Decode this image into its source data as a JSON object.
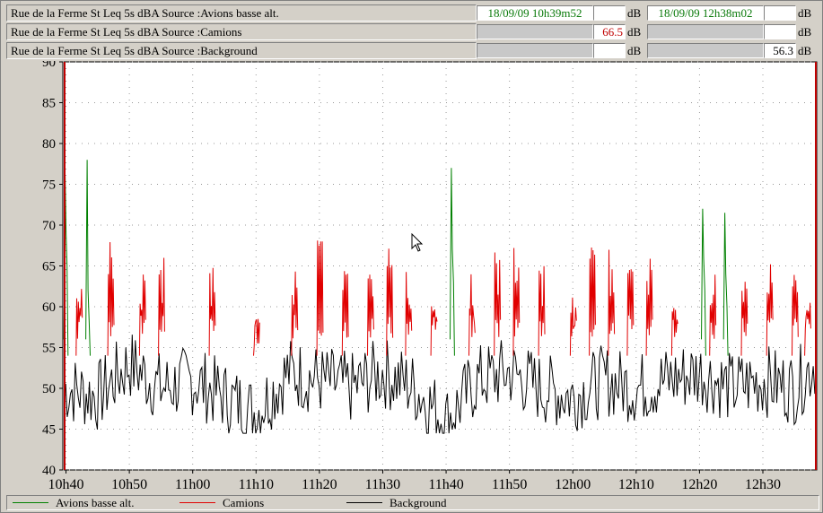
{
  "header_rows": [
    {
      "label": "Rue de la Ferme St  Leq 5s  dBA  Source :Avions basse alt.",
      "value1": "18/09/09 10h39m52",
      "unit1": "dB",
      "value2": "18/09/09 12h38m02",
      "unit2": "dB"
    },
    {
      "label": "Rue de la Ferme St  Leq 5s  dBA  Source :Camions",
      "value1": "66.5",
      "unit1": "dB",
      "value2": "",
      "unit2": "dB"
    },
    {
      "label": "Rue de la Ferme St  Leq 5s  dBA  Source :Background",
      "value1": "",
      "unit1": "dB",
      "value2": "56.3",
      "unit2": "dB"
    }
  ],
  "colors": {
    "avions": "#008000",
    "camions": "#e00000",
    "background": "#000000",
    "value_green": "#0a7a0a",
    "value_red": "#c00000"
  },
  "chart_data": {
    "type": "line",
    "ylim": [
      40,
      90
    ],
    "yticks": [
      "40",
      "45",
      "50",
      "55",
      "60",
      "65",
      "70",
      "75",
      "80",
      "85",
      "90"
    ],
    "xticks": [
      "10h40",
      "10h50",
      "11h00",
      "11h10",
      "11h20",
      "11h30",
      "11h40",
      "11h50",
      "12h00",
      "12h10",
      "12h20",
      "12h30"
    ],
    "grid": true,
    "legend_position": "bottom",
    "series": [
      {
        "name": "Avions basse alt.",
        "color": "#008000",
        "points": [
          [
            "10h39m52",
            76
          ],
          [
            "10h40m10",
            65
          ],
          [
            "10h43m20",
            78
          ],
          [
            "10h43m40",
            58
          ],
          [
            "11h40m50",
            77
          ],
          [
            "11h41m10",
            63
          ],
          [
            "12h20m30",
            72
          ],
          [
            "12h20m50",
            62
          ],
          [
            "12h24m00",
            71.5
          ],
          [
            "12h24m20",
            60
          ]
        ]
      },
      {
        "name": "Camions",
        "color": "#e00000",
        "points": [
          [
            "10h42m",
            64
          ],
          [
            "10h47m",
            68
          ],
          [
            "10h52m",
            65
          ],
          [
            "10h55m",
            66
          ],
          [
            "11h03m",
            66
          ],
          [
            "11h10m",
            60
          ],
          [
            "11h16m",
            65
          ],
          [
            "11h20m",
            69
          ],
          [
            "11h24m",
            65
          ],
          [
            "11h28m",
            67
          ],
          [
            "11h31m",
            68
          ],
          [
            "11h34m",
            65
          ],
          [
            "11h38m",
            64
          ],
          [
            "11h44m",
            64
          ],
          [
            "11h48m",
            67
          ],
          [
            "11h51m",
            68
          ],
          [
            "11h55m",
            65
          ],
          [
            "12h00m",
            63
          ],
          [
            "12h03m",
            68
          ],
          [
            "12h06m",
            67
          ],
          [
            "12h09m",
            65
          ],
          [
            "12h12m",
            67
          ],
          [
            "12h16m",
            64
          ],
          [
            "12h22m",
            66
          ],
          [
            "12h27m",
            64
          ],
          [
            "12h31m",
            66
          ],
          [
            "12h35m",
            65
          ],
          [
            "12h37m",
            62
          ]
        ]
      },
      {
        "name": "Background",
        "color": "#000000",
        "points": [
          [
            "10h40m",
            50
          ],
          [
            "10h45m",
            49
          ],
          [
            "10h50m",
            53
          ],
          [
            "10h55m",
            50
          ],
          [
            "11h00m",
            51
          ],
          [
            "11h05m",
            49
          ],
          [
            "11h10m",
            47
          ],
          [
            "11h15m",
            52
          ],
          [
            "11h20m",
            51
          ],
          [
            "11h25m",
            50
          ],
          [
            "11h30m",
            52
          ],
          [
            "11h35m",
            50
          ],
          [
            "11h40m",
            46
          ],
          [
            "11h45m",
            51
          ],
          [
            "11h50m",
            52
          ],
          [
            "11h55m",
            50
          ],
          [
            "12h00m",
            49
          ],
          [
            "12h05m",
            51
          ],
          [
            "12h10m",
            50
          ],
          [
            "12h15m",
            51
          ],
          [
            "12h20m",
            52
          ],
          [
            "12h25m",
            50
          ],
          [
            "12h30m",
            51
          ],
          [
            "12h35m",
            50
          ],
          [
            "12h38m",
            53
          ]
        ]
      }
    ]
  },
  "legend": [
    {
      "label": "Avions basse alt.",
      "color": "#008000"
    },
    {
      "label": "Camions",
      "color": "#e00000"
    },
    {
      "label": "Background",
      "color": "#000000"
    }
  ]
}
